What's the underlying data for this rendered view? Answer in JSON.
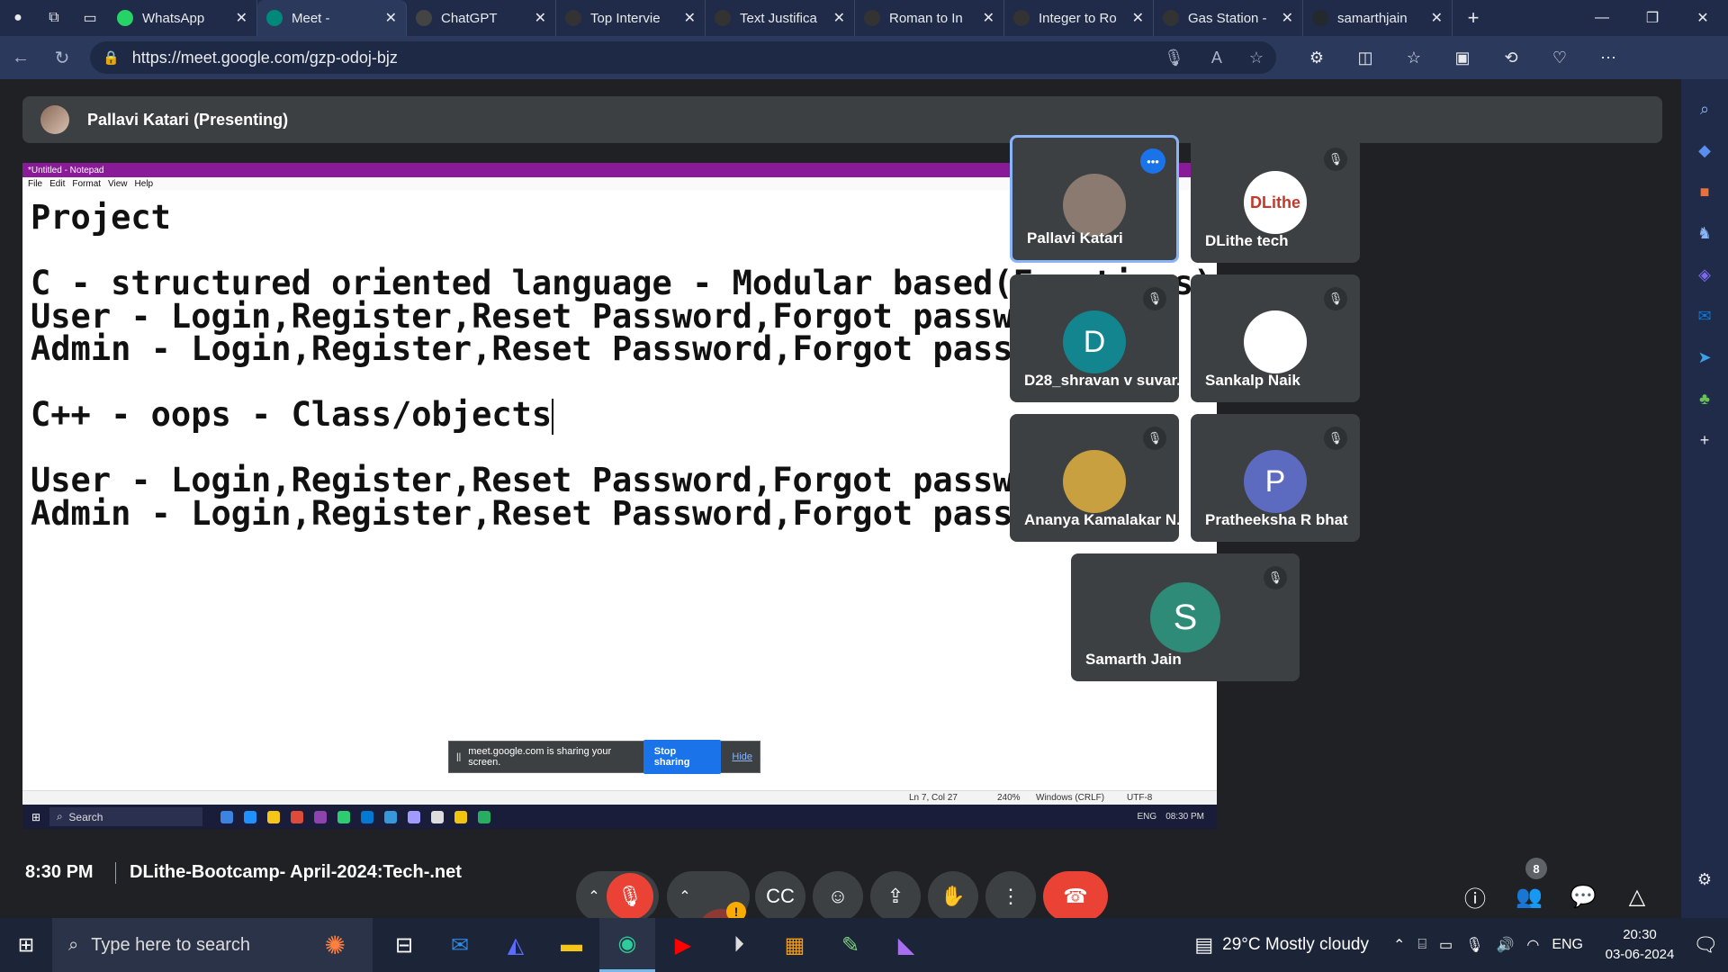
{
  "browser": {
    "tabs": [
      {
        "title": "WhatsApp",
        "icon": "whatsapp-icon",
        "color": "#25d366"
      },
      {
        "title": "Meet -",
        "icon": "meet-icon",
        "color": "#00897b",
        "active": true
      },
      {
        "title": "ChatGPT",
        "icon": "chatgpt-icon",
        "color": "#444"
      },
      {
        "title": "Top Intervie",
        "icon": "leetcode-icon",
        "color": "#333"
      },
      {
        "title": "Text Justifica",
        "icon": "leetcode-icon",
        "color": "#333"
      },
      {
        "title": "Roman to In",
        "icon": "leetcode-icon",
        "color": "#333"
      },
      {
        "title": "Integer to Ro",
        "icon": "leetcode-icon",
        "color": "#333"
      },
      {
        "title": "Gas Station -",
        "icon": "leetcode-icon",
        "color": "#333"
      },
      {
        "title": "samarthjain",
        "icon": "github-icon",
        "color": "#24292e"
      }
    ],
    "url": "https://meet.google.com/gzp-odoj-bjz"
  },
  "meet": {
    "presenter_label": "Pallavi Katari (Presenting)",
    "time": "8:30 PM",
    "meeting_title": "DLithe-Bootcamp- April-2024:Tech-.net",
    "participant_count": "8",
    "sharing_notice": "meet.google.com is sharing your screen.",
    "stop_sharing": "Stop sharing",
    "hide": "Hide",
    "warning_mark": "!",
    "participants": [
      {
        "name": "Pallavi Katari",
        "avatar_color": "#8a7a70",
        "initial": "",
        "speaking": true
      },
      {
        "name": "DLithe tech",
        "avatar_color": "#ffffff",
        "initial": "DLithe",
        "muted": true
      },
      {
        "name": "D28_shravan v suvar...",
        "avatar_color": "#12858f",
        "initial": "D",
        "muted": true
      },
      {
        "name": "Sankalp Naik",
        "avatar_color": "#ffffff",
        "initial": "",
        "muted": true
      },
      {
        "name": "Ananya Kamalakar N...",
        "avatar_color": "#c8a040",
        "initial": "",
        "muted": true
      },
      {
        "name": "Pratheeksha R bhat",
        "avatar_color": "#5c6bc0",
        "initial": "P",
        "muted": true
      },
      {
        "name": "Samarth Jain",
        "avatar_color": "#2e8b78",
        "initial": "S",
        "muted": true
      }
    ]
  },
  "notepad": {
    "title": "*Untitled - Notepad",
    "menu": [
      "File",
      "Edit",
      "Format",
      "View",
      "Help"
    ],
    "lines": [
      "Project",
      "",
      "C - structured oriented language - Modular based(Functions)",
      "User - Login,Register,Reset Password,Forgot password",
      "Admin - Login,Register,Reset Password,Forgot password",
      "",
      "C++ - oops - Class/objects",
      "",
      "User - Login,Register,Reset Password,Forgot password",
      "Admin - Login,Register,Reset Password,Forgot password"
    ],
    "status": {
      "pos": "Ln 7, Col 27",
      "zoom": "240%",
      "eol": "Windows (CRLF)",
      "enc": "UTF-8"
    },
    "inner_search": "Search",
    "inner_tray": {
      "lang": "ENG",
      "time": "08:30 PM"
    }
  },
  "taskbar": {
    "search_placeholder": "Type here to search",
    "weather": "29°C  Mostly cloudy",
    "lang": "ENG",
    "time": "20:30",
    "date": "03-06-2024"
  }
}
